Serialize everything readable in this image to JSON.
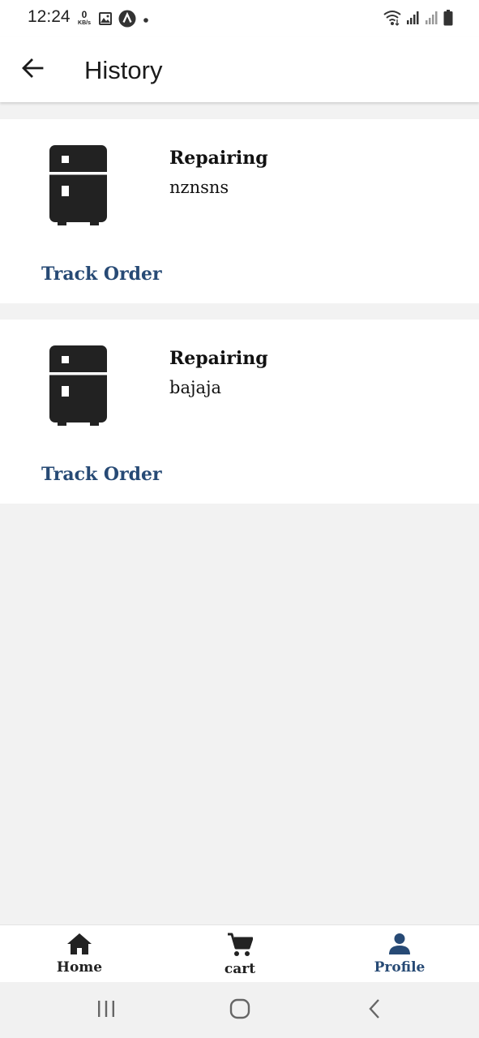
{
  "status_bar": {
    "time": "12:24",
    "speed_value": "0",
    "speed_unit": "KB/s",
    "left_icons": [
      "image-icon",
      "app-notification-icon",
      "dot-icon"
    ],
    "right_icons": [
      "wifi-icon",
      "signal-icon",
      "signal-icon",
      "battery-icon"
    ]
  },
  "app_bar": {
    "back_icon": "arrow-left-icon",
    "title": "History"
  },
  "orders": [
    {
      "icon": "fridge-icon",
      "title": "Repairing",
      "subtitle": "nznsns",
      "action": "Track Order"
    },
    {
      "icon": "fridge-icon",
      "title": "Repairing",
      "subtitle": "bajaja",
      "action": "Track Order"
    }
  ],
  "bottom_nav": [
    {
      "icon": "home-icon",
      "label": "Home",
      "active": false
    },
    {
      "icon": "cart-icon",
      "label": "cart",
      "active": false
    },
    {
      "icon": "person-icon",
      "label": "Profile",
      "active": true
    }
  ],
  "colors": {
    "accent": "#274a75",
    "background": "#f2f2f2",
    "card": "#ffffff",
    "text": "#111111"
  }
}
